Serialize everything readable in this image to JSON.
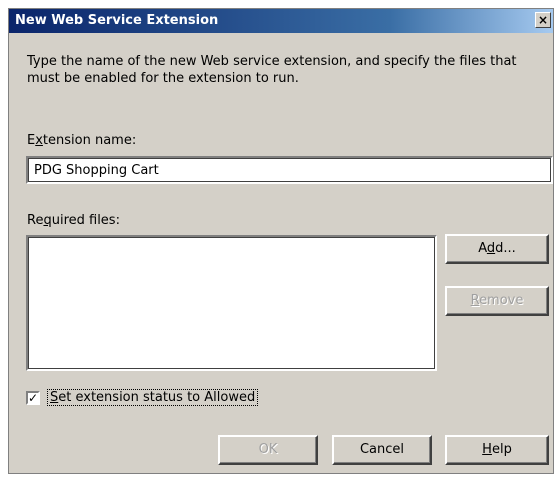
{
  "window": {
    "title": "New Web Service Extension",
    "close_glyph": "×"
  },
  "instructions": "Type the name of the new Web service extension, and specify the files that must be enabled for the extension to run.",
  "extension_name": {
    "label_before": "E",
    "label_mnemonic": "x",
    "label_after": "tension name:",
    "value": "PDG Shopping Cart"
  },
  "required_files": {
    "label_before": "Re",
    "label_mnemonic": "q",
    "label_after": "uired files:",
    "items": []
  },
  "buttons": {
    "add": {
      "before": "A",
      "mnemonic": "d",
      "after": "d..."
    },
    "remove": {
      "before": "",
      "mnemonic": "R",
      "after": "emove"
    },
    "ok": "OK",
    "cancel": "Cancel",
    "help": {
      "before": "",
      "mnemonic": "H",
      "after": "elp"
    }
  },
  "allowed_checkbox": {
    "checked": true,
    "check_glyph": "✓",
    "label_before": "",
    "label_mnemonic": "S",
    "label_after": "et extension status to Allowed"
  }
}
